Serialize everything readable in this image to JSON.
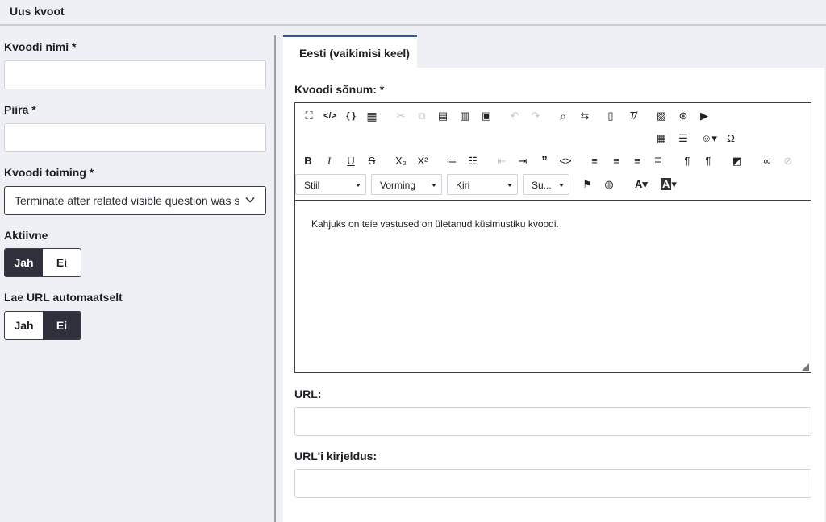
{
  "header": {
    "title": "Uus kvoot"
  },
  "form": {
    "quota_name": {
      "label": "Kvoodi nimi *",
      "value": ""
    },
    "limit": {
      "label": "Piira *",
      "value": ""
    },
    "action": {
      "label": "Kvoodi toiming *",
      "selected": "Terminate after related visible question was submitted"
    },
    "active": {
      "label": "Aktiivne",
      "yes": "Jah",
      "no": "Ei",
      "selected": "Jah"
    },
    "autoload_url": {
      "label": "Lae URL automaatselt",
      "yes": "Jah",
      "no": "Ei",
      "selected": "Ei"
    }
  },
  "language_tab": {
    "label": "Eesti (vaikimisi keel)"
  },
  "message": {
    "label": "Kvoodi sõnum: *",
    "content": "Kahjuks on teie vastused on ületanud küsimustiku kvoodi."
  },
  "editor_toolbar": {
    "style_label": "Stiil",
    "format_label": "Vorming",
    "font_label": "Kiri",
    "size_label": "Su..."
  },
  "url": {
    "label": "URL:",
    "value": ""
  },
  "url_description": {
    "label": "URL'i kirjeldus:",
    "value": ""
  }
}
